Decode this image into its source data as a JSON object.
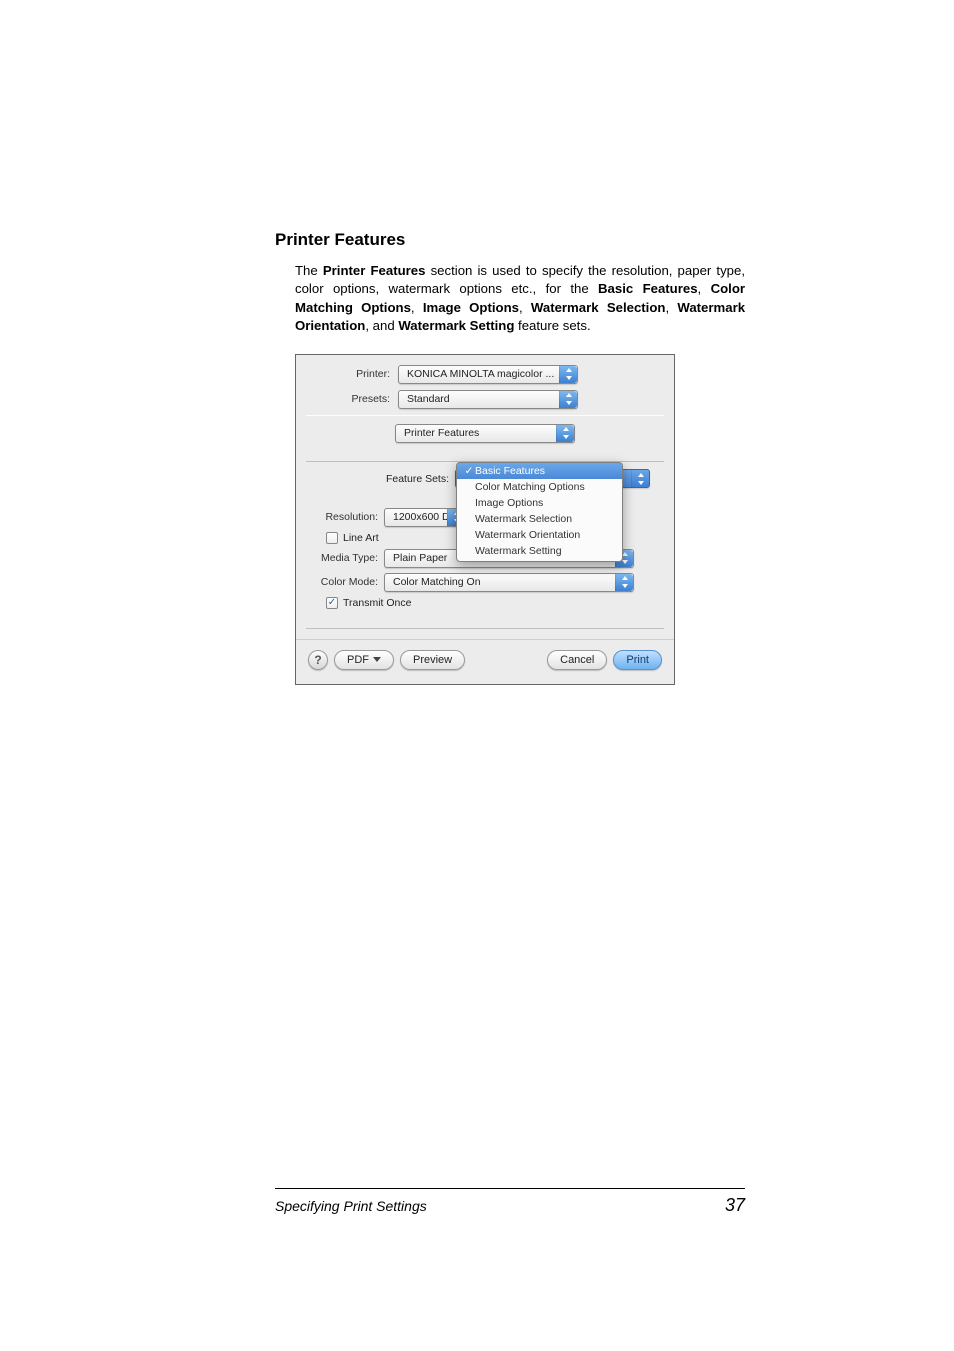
{
  "section": {
    "heading": "Printer Features",
    "para_1a": "The ",
    "para_1b": "Printer Features",
    "para_1c": " section is used to specify the resolution, paper type, color options, watermark options etc., for the ",
    "para_1d": "Basic Features",
    "para_1e": ", ",
    "para_1f": "Color Matching Options",
    "para_1g": ", ",
    "para_1h": "Image Options",
    "para_1i": ", ",
    "para_1j": "Watermark Selection",
    "para_1k": ", ",
    "para_1l": "Watermark Orientation",
    "para_1m": ", and ",
    "para_1n": "Watermark Setting",
    "para_1o": " feature sets."
  },
  "dialog": {
    "printer_label": "Printer:",
    "printer_value": "KONICA MINOLTA magicolor ...",
    "presets_label": "Presets:",
    "presets_value": "Standard",
    "category_value": "Printer Features",
    "feature_sets_label": "Feature Sets:",
    "feature_sets_value": "Basic Features",
    "popup_items": {
      "i0": "Basic Features",
      "i1": "Color Matching Options",
      "i2": "Image Options",
      "i3": "Watermark Selection",
      "i4": "Watermark Orientation",
      "i5": "Watermark Setting"
    },
    "resolution_label": "Resolution:",
    "resolution_value": "1200x600 D",
    "lineart_label": "Line Art",
    "mediatype_label": "Media Type:",
    "mediatype_value": "Plain Paper",
    "colormode_label": "Color Mode:",
    "colormode_value": "Color Matching On",
    "transmit_label": "Transmit Once",
    "help": "?",
    "pdf": "PDF",
    "preview": "Preview",
    "cancel": "Cancel",
    "print": "Print",
    "checkmark": "✓"
  },
  "footer": {
    "title": "Specifying Print Settings",
    "page": "37"
  }
}
